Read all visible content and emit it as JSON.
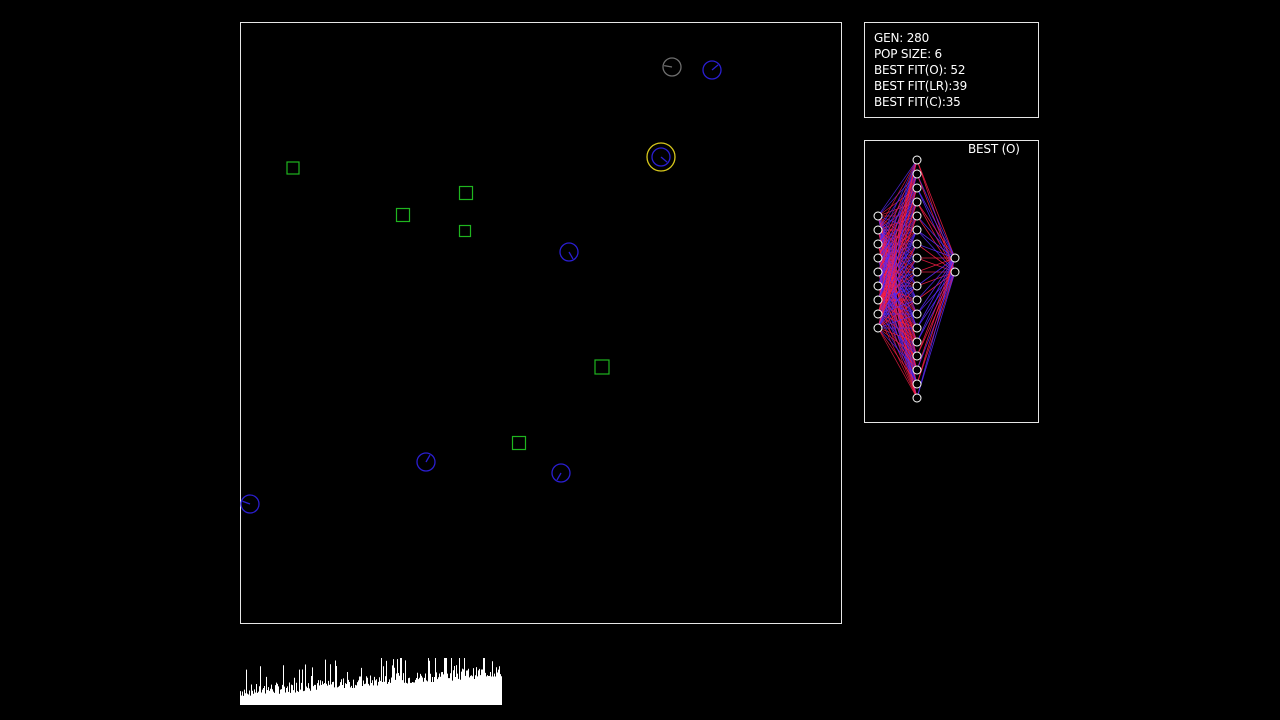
{
  "stats": {
    "generation": "GEN: 280",
    "population_size": "POP SIZE: 6",
    "best_fit_o": "BEST FIT(O): 52",
    "best_fit_lr": "BEST FIT(LR):39",
    "best_fit_c": "BEST FIT(C):35"
  },
  "network_panel": {
    "title": "BEST (O)"
  },
  "colors": {
    "frame": "#e6e6e6",
    "food": "#1fb51f",
    "agent": "#2a1ecf",
    "best_highlight": "#d8c81c",
    "dead_agent": "#6e6e6e",
    "net_positive": "#ff1f4a",
    "net_negative": "#5a2cff",
    "history": "#ffffff"
  }
}
